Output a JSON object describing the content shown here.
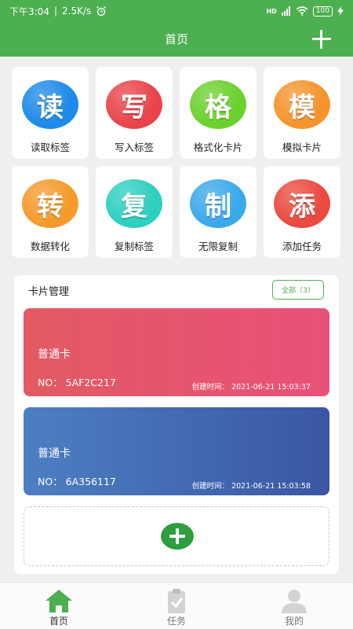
{
  "status_bar": {
    "time": "下午3:04",
    "speed": "2.5K/s",
    "network": "HD",
    "battery": "100"
  },
  "header": {
    "title": "首页"
  },
  "functions": [
    {
      "glyph": "读",
      "label": "读取标签",
      "color": "#1e8ae9"
    },
    {
      "glyph": "写",
      "label": "写入标签",
      "color": "#e8444a"
    },
    {
      "glyph": "格",
      "label": "格式化卡片",
      "color": "#6bd12d"
    },
    {
      "glyph": "模",
      "label": "模拟卡片",
      "color": "#f5942d"
    },
    {
      "glyph": "转",
      "label": "数据转化",
      "color": "#f59a2b"
    },
    {
      "glyph": "复",
      "label": "复制标签",
      "color": "#2dcfc0"
    },
    {
      "glyph": "制",
      "label": "无限复制",
      "color": "#3aa9ea"
    },
    {
      "glyph": "添",
      "label": "添加任务",
      "color": "#ea4a40"
    }
  ],
  "card_management": {
    "title": "卡片管理",
    "all_button": "全部（3）",
    "cards": [
      {
        "type": "普通卡",
        "no": "NO：  5AF2C217",
        "created": "创建时间：  2021-06-21  15:03:37"
      },
      {
        "type": "普通卡",
        "no": "NO：  6A356117",
        "created": "创建时间：  2021-06-21  15:03:58"
      }
    ]
  },
  "bottom_nav": {
    "items": [
      {
        "label": "首页",
        "icon": "home-icon",
        "active": true
      },
      {
        "label": "任务",
        "icon": "clipboard-icon",
        "active": false
      },
      {
        "label": "我的",
        "icon": "user-icon",
        "active": false
      }
    ]
  }
}
